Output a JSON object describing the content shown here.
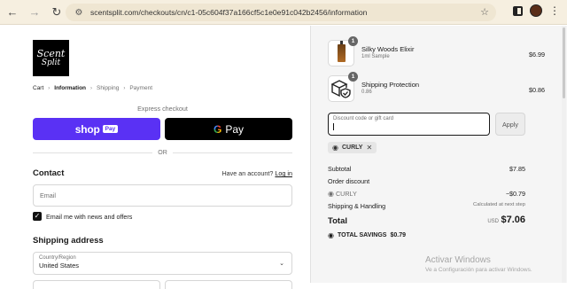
{
  "browser": {
    "url": "scentsplit.com/checkouts/cn/c1-05c604f37a166cf5c1e0e91c042b2456/information",
    "back_icon": "arrow-left-icon",
    "forward_icon": "arrow-right-icon",
    "reload_icon": "reload-icon"
  },
  "brand": {
    "logo_line1": "Scent",
    "logo_line2": "Split"
  },
  "breadcrumb": {
    "cart": "Cart",
    "information": "Information",
    "shipping": "Shipping",
    "payment": "Payment"
  },
  "express": {
    "label": "Express checkout",
    "shop_pay_word": "shop",
    "shop_pay_badge": "Pay",
    "gpay_g": "G",
    "gpay_pay": "Pay",
    "or": "OR"
  },
  "contact": {
    "heading": "Contact",
    "have_account": "Have an account?",
    "login": "Log in",
    "email_placeholder": "Email",
    "news_checkbox": "Email me with news and offers",
    "news_checked": true
  },
  "shipping": {
    "heading": "Shipping address",
    "country_label": "Country/Region",
    "country_value": "United States"
  },
  "order": {
    "items": [
      {
        "name": "Silky Woods Elixir",
        "sub": "1ml Sample",
        "price": "$6.99",
        "qty": "1"
      },
      {
        "name": "Shipping Protection",
        "sub": "0.86",
        "price": "$0.86",
        "qty": "1"
      }
    ],
    "discount_placeholder": "Discount code or gift card",
    "apply_label": "Apply",
    "code_tag": "CURLY",
    "subtotal_label": "Subtotal",
    "subtotal_value": "$7.85",
    "order_discount_label": "Order discount",
    "code_label": "CURLY",
    "code_value": "−$0.79",
    "shipping_label": "Shipping & Handling",
    "shipping_value": "Calculated at next step",
    "total_label": "Total",
    "total_currency": "USD",
    "total_value": "$7.06",
    "savings_label": "TOTAL SAVINGS",
    "savings_value": "$0.79"
  },
  "watermark": {
    "line1": "Activar Windows",
    "line2": "Ve a Configuración para activar Windows."
  },
  "colors": {
    "shop_pay": "#5a31f4",
    "gpay": "#000000",
    "panel_bg": "#f5f5f5"
  }
}
